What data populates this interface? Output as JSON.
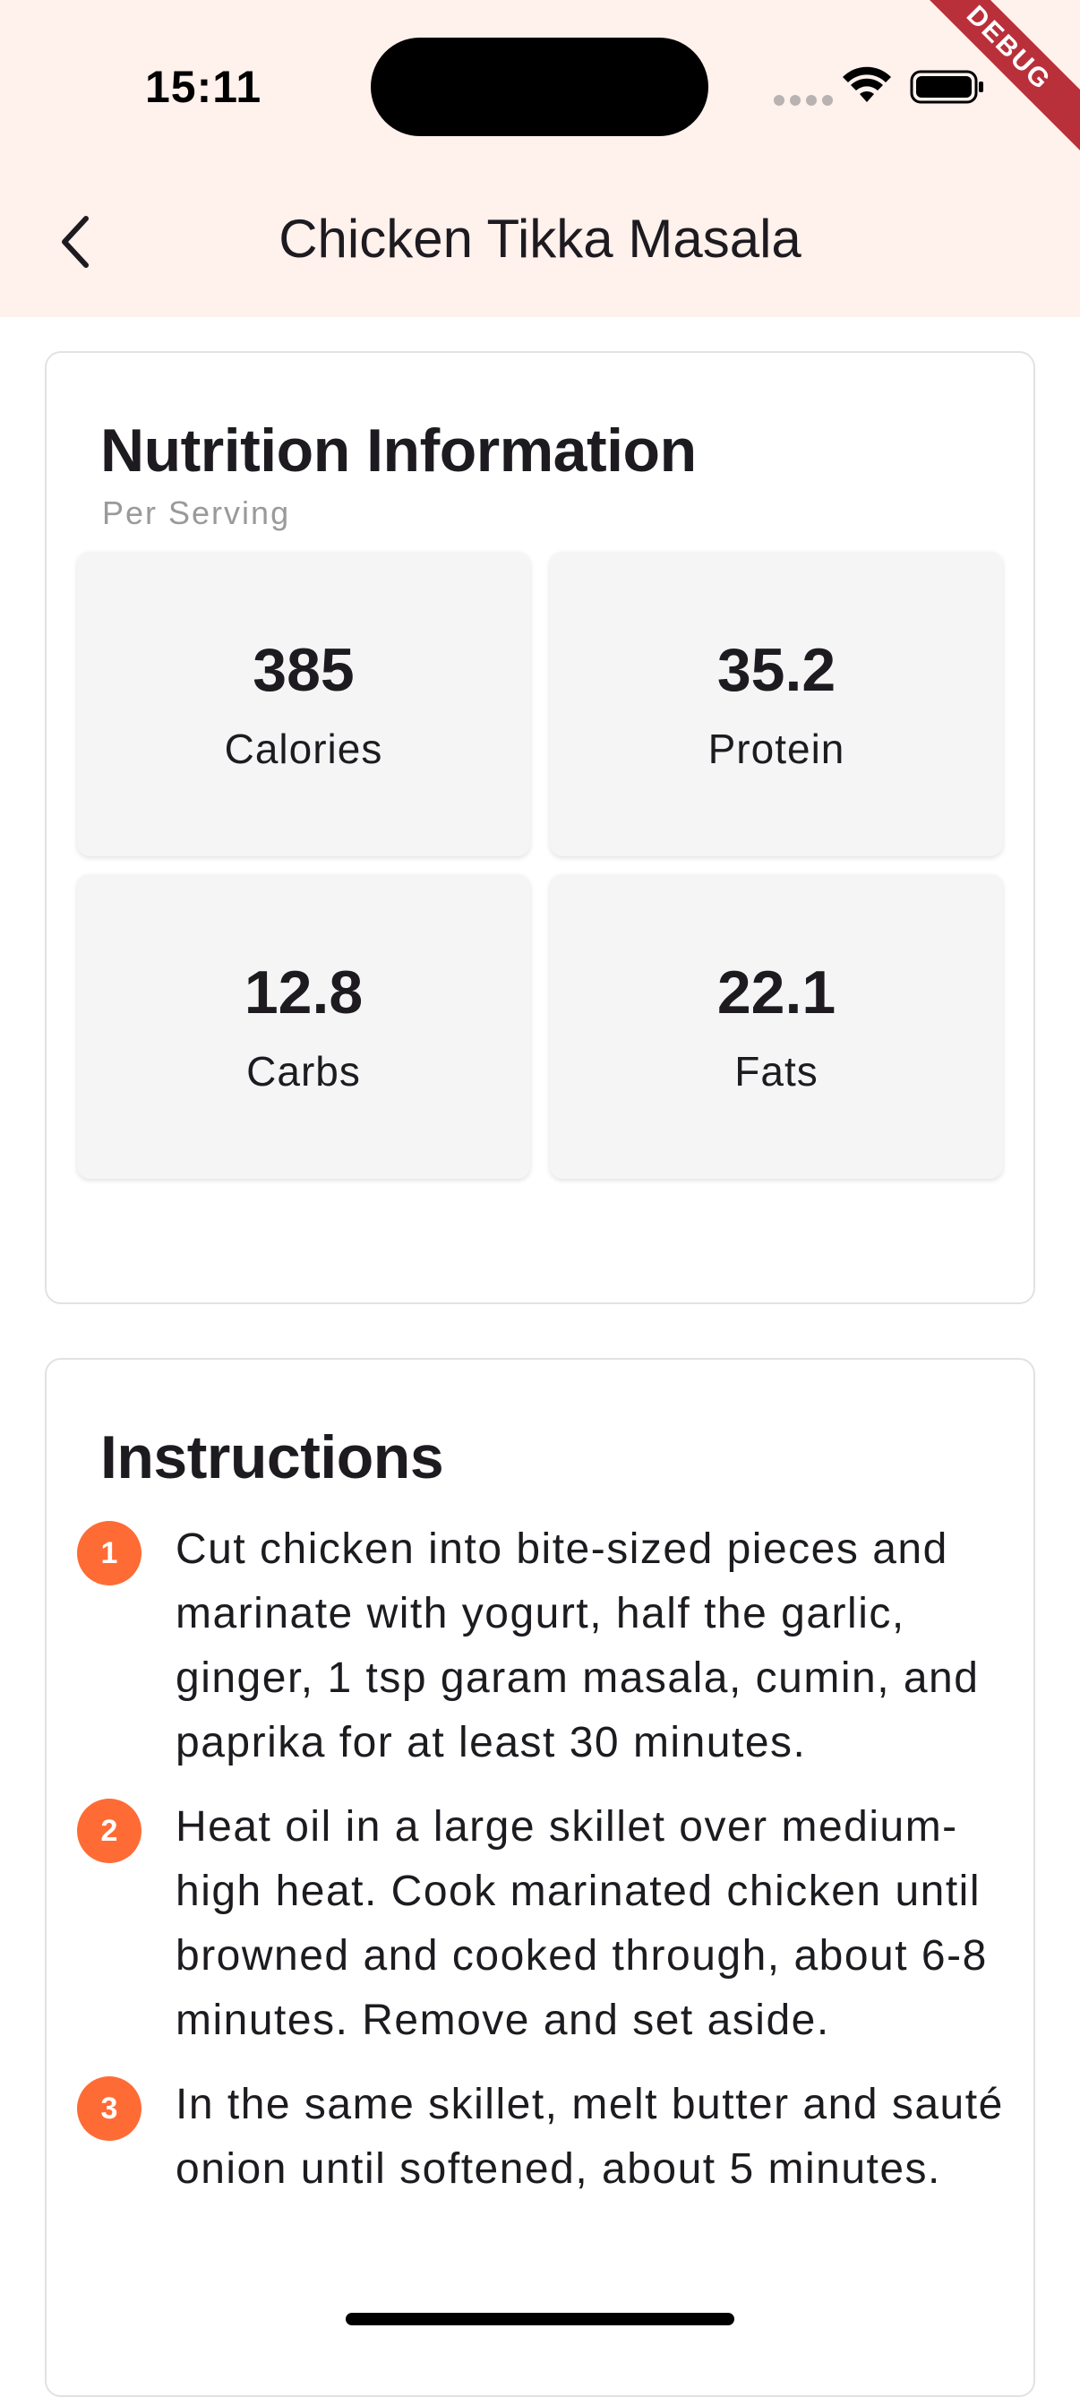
{
  "status_bar": {
    "time": "15:11",
    "icons": [
      "signal-dots-icon",
      "wifi-icon",
      "battery-icon"
    ],
    "debug_banner": "DEBUG"
  },
  "app_bar": {
    "back_icon": "chevron-left-icon",
    "title": "Chicken Tikka Masala",
    "background": "#FFF1EC"
  },
  "nutrition": {
    "title": "Nutrition Information",
    "subtitle": "Per Serving",
    "items": [
      {
        "value": "385",
        "label": "Calories"
      },
      {
        "value": "35.2",
        "label": "Protein"
      },
      {
        "value": "12.8",
        "label": "Carbs"
      },
      {
        "value": "22.1",
        "label": "Fats"
      }
    ]
  },
  "instructions": {
    "title": "Instructions",
    "accent": "#FF6B35",
    "steps": [
      {
        "number": "1",
        "text": "Cut chicken into bite-sized pieces and marinate with yogurt, half the garlic, ginger, 1 tsp garam masala, cumin, and paprika for at least 30 minutes."
      },
      {
        "number": "2",
        "text": "Heat oil in a large skillet over medium-high heat. Cook marinated chicken until browned and cooked through, about 6-8 minutes. Remove and set aside."
      },
      {
        "number": "3",
        "text": "In the same skillet, melt butter and sauté onion until softened, about 5 minutes."
      }
    ]
  }
}
